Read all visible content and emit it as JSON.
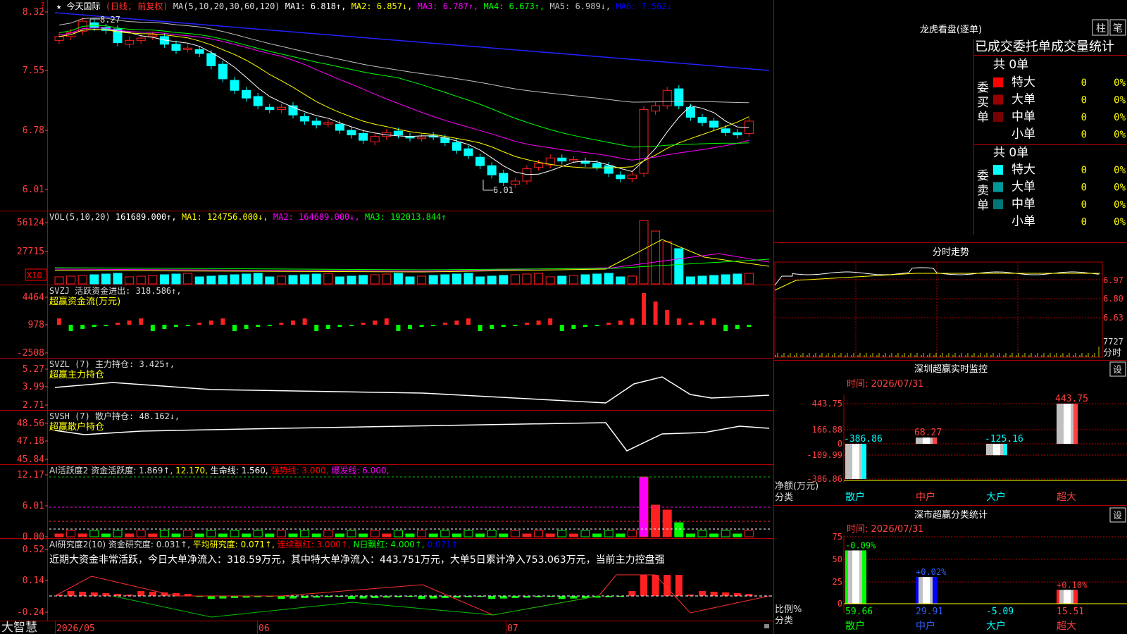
{
  "header": {
    "star": "★",
    "stock_name": "今天国际",
    "mode": "(日线, 前复权)",
    "ma_items": [
      {
        "label": "MA(5,10,20,30,60,120)",
        "color": "#dddddd"
      },
      {
        "label": "MA1: 6.818↑,",
        "color": "#ffffff"
      },
      {
        "label": "MA2: 6.857↓,",
        "color": "#ffff00"
      },
      {
        "label": "MA3: 6.787↑,",
        "color": "#ff00ff"
      },
      {
        "label": "MA4: 6.673↑,",
        "color": "#00ff00"
      },
      {
        "label": "MA5: 6.989↓,",
        "color": "#c0c0c0"
      },
      {
        "label": "MA6: 7.562↓",
        "color": "#0000ff"
      }
    ]
  },
  "price_axis": [
    "8.32",
    "7.55",
    "6.78",
    "6.01"
  ],
  "price_annotations": {
    "high": "8.27",
    "low": "6.01"
  },
  "vol_panel": {
    "axis": [
      "56124",
      "27715"
    ],
    "x10": "X10",
    "items": [
      {
        "label": "VOL(5,10,20)",
        "color": "#dddddd"
      },
      {
        "label": "161689.000↑,",
        "color": "#ffffff"
      },
      {
        "label": "MA1: 124756.000↓,",
        "color": "#ffff00"
      },
      {
        "label": "MA2: 164689.000↓,",
        "color": "#ff00ff"
      },
      {
        "label": "MA3: 192013.844↑",
        "color": "#00ff00"
      }
    ]
  },
  "svzj_panel": {
    "axis": [
      "4464",
      "978",
      "-2508"
    ],
    "line1": [
      {
        "label": "SVZJ  活跃资金进出: 318.586↑,",
        "color": "#dddddd"
      }
    ],
    "line2": "超赢资金流(万元)"
  },
  "svzl_panel": {
    "axis": [
      "5.27",
      "3.99",
      "2.71"
    ],
    "line1": [
      {
        "label": "SVZL (7) 主力持仓: 3.425↑,",
        "color": "#dddddd"
      }
    ],
    "line2": "超赢主力持仓"
  },
  "svsh_panel": {
    "axis": [
      "48.56",
      "47.18",
      "45.84"
    ],
    "line1": [
      {
        "label": "SVSH (7) 散户持仓: 48.162↓,",
        "color": "#dddddd"
      }
    ],
    "line2": "超赢散户持仓"
  },
  "ai_active_panel": {
    "axis": [
      "12.17",
      "6.01",
      "0.00"
    ],
    "items": [
      {
        "label": "AI活跃度2 资金活跃度: 1.869↑,",
        "color": "#dddddd"
      },
      {
        "label": "12.170,",
        "color": "#ffff00"
      },
      {
        "label": "生命线: 1.560,",
        "color": "#ffffff"
      },
      {
        "label": "强势线: 3.000,",
        "color": "#ff0000"
      },
      {
        "label": "爆发线: 6.000,",
        "color": "#ff00ff"
      }
    ]
  },
  "ai_research_panel": {
    "axis": [
      "0.52",
      "0.14",
      "-0.24"
    ],
    "items": [
      {
        "label": "AI研究度2(10) 资金研究度: 0.031↑,",
        "color": "#dddddd"
      },
      {
        "label": "平均研究度: 0.071↑,",
        "color": "#ffff00"
      },
      {
        "label": "连续飘红: 3.000↑,",
        "color": "#ff0000"
      },
      {
        "label": "N日飘红: 4.000↑,",
        "color": "#00ff00"
      },
      {
        "label": "0.071↑",
        "color": "#0000ff"
      }
    ],
    "summary": "近期大资金非常活跃，今日大单净流入：318.59万元，其中特大单净流入：443.751万元，大单5日累计净入753.063万元，当前主力控盘强"
  },
  "bottom_bar": {
    "brand": "大智慧",
    "dates": [
      "2026/05",
      "06",
      "07"
    ]
  },
  "right_panel": {
    "title": "龙虎看盘(逐单)",
    "btn_zhu": "柱",
    "btn_bi": "笔",
    "stat_title": "已成交委托单成交量统计",
    "buy_label": "委买单",
    "sell_label": "委卖单",
    "buy_total": "共 0单",
    "sell_total": "共 0单",
    "buy_rows": [
      {
        "label": "特大",
        "count": "0",
        "pct": "0%",
        "color": "#ff0000"
      },
      {
        "label": "大单",
        "count": "0",
        "pct": "0%",
        "color": "#990000"
      },
      {
        "label": "中单",
        "count": "0",
        "pct": "0%",
        "color": "#770000"
      },
      {
        "label": "小单",
        "count": "0",
        "pct": "0%",
        "color": ""
      }
    ],
    "sell_rows": [
      {
        "label": "特大",
        "count": "0",
        "pct": "0%",
        "color": "#00ffff"
      },
      {
        "label": "大单",
        "count": "0",
        "pct": "0%",
        "color": "#009999"
      },
      {
        "label": "中单",
        "count": "0",
        "pct": "0%",
        "color": "#007777"
      },
      {
        "label": "小单",
        "count": "0",
        "pct": "0%",
        "color": ""
      }
    ],
    "timeshare": {
      "title": "分时走势",
      "axis": [
        "6.97",
        "6.80",
        "6.63"
      ],
      "vol_max": "7727",
      "unit": "分时"
    },
    "monitor": {
      "title": "深圳超赢实时监控",
      "set_btn": "设",
      "time": "时间: 2026/07/31",
      "axis": [
        "443.75",
        "166.88",
        "0",
        "-109.99",
        "-386.86"
      ],
      "ylabel1": "净额(万元)",
      "ylabel2": "分类",
      "chart_data": {
        "type": "bar",
        "categories": [
          "散户",
          "中户",
          "大户",
          "超大"
        ],
        "values": [
          -386.86,
          68.27,
          -125.16,
          443.75
        ],
        "value_labels": [
          "-386.86",
          "68.27",
          "-125.16",
          "443.75"
        ],
        "ylim": [
          -386.86,
          443.75
        ],
        "ylabel": "净额(万元)",
        "xlabel": "分类"
      }
    },
    "classify": {
      "title": "深市超赢分类统计",
      "set_btn": "设",
      "time": "时间: 2026/07/31",
      "axis": [
        "75",
        "50",
        "25",
        "0"
      ],
      "ylabel1": "比例%",
      "ylabel2": "分类",
      "chart_data": {
        "type": "bar",
        "categories": [
          "散户",
          "中户",
          "大户",
          "超大"
        ],
        "values": [
          59.66,
          29.91,
          -5.09,
          15.51
        ],
        "value_labels": [
          "59.66",
          "29.91",
          "-5.09",
          "15.51"
        ],
        "changes": [
          "-0.09%",
          "+0.02%",
          "",
          "+0.10%"
        ],
        "ylim": [
          0,
          75
        ],
        "ylabel": "比例%",
        "xlabel": "分类"
      }
    }
  }
}
